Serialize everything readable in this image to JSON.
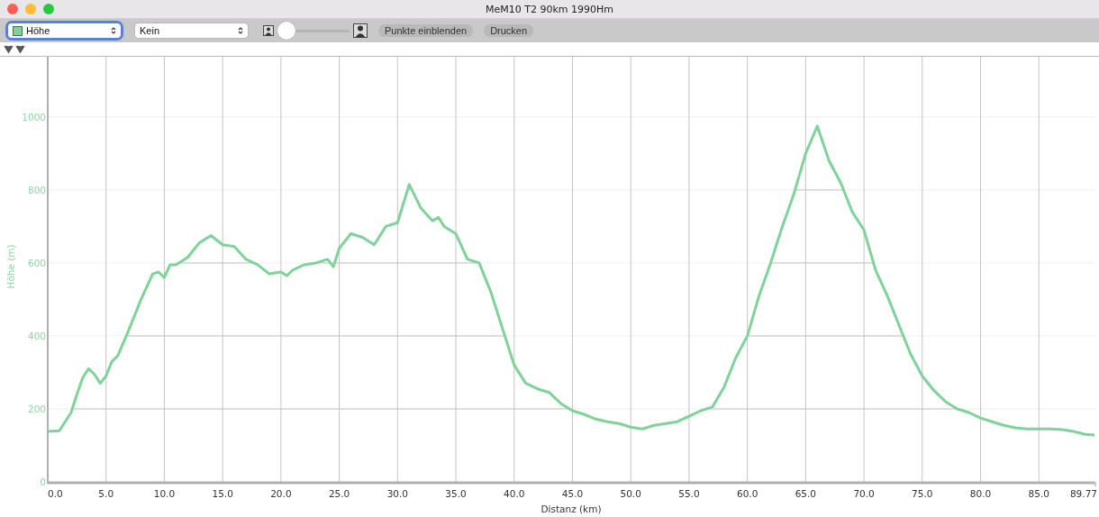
{
  "window": {
    "title": "MeM10 T2 90km 1990Hm"
  },
  "toolbar": {
    "selects": [
      {
        "value": "Höhe",
        "focused": true,
        "color": "#7fd39a"
      },
      {
        "value": "Kein",
        "focused": false
      }
    ],
    "zoom_slider": {
      "level": 0
    },
    "buttons": [
      "Punkte einblenden",
      "Drucken"
    ]
  },
  "chart": {
    "chart_data": {
      "type": "line",
      "xlabel": "Distanz (km)",
      "ylabel": "Höhe (m)",
      "x": [
        0,
        1,
        2,
        2.5,
        3,
        3.5,
        4,
        4.5,
        5,
        5.5,
        6,
        7,
        8,
        9,
        9.5,
        10,
        10.5,
        11,
        12,
        13,
        14,
        15,
        16,
        17,
        18,
        19,
        20,
        20.5,
        21,
        22,
        23,
        24,
        24.5,
        25,
        26,
        27,
        28,
        29,
        30,
        31,
        32,
        33,
        33.5,
        34,
        35,
        36,
        37,
        38,
        39,
        40,
        41,
        42,
        43,
        44,
        45,
        46,
        47,
        48,
        49,
        50,
        51,
        52,
        53,
        54,
        55,
        56,
        57,
        58,
        59,
        60,
        61,
        62,
        63,
        64,
        65,
        66,
        67,
        68,
        69,
        70,
        71,
        72,
        73,
        74,
        75,
        76,
        77,
        78,
        79,
        80,
        81,
        82,
        83,
        84,
        85,
        86,
        87,
        88,
        89,
        89.77
      ],
      "series": [
        {
          "color": "#7fd39a",
          "values": [
            138,
            140,
            190,
            240,
            285,
            310,
            295,
            270,
            290,
            330,
            345,
            420,
            500,
            570,
            575,
            560,
            595,
            595,
            615,
            655,
            675,
            650,
            645,
            610,
            595,
            570,
            575,
            565,
            580,
            595,
            600,
            610,
            590,
            640,
            680,
            670,
            650,
            700,
            710,
            815,
            750,
            715,
            725,
            700,
            680,
            610,
            600,
            520,
            420,
            320,
            270,
            255,
            245,
            215,
            195,
            185,
            172,
            165,
            160,
            150,
            145,
            155,
            160,
            165,
            180,
            195,
            205,
            260,
            340,
            400,
            510,
            600,
            700,
            790,
            900,
            975,
            880,
            820,
            740,
            690,
            580,
            510,
            430,
            350,
            290,
            250,
            220,
            200,
            190,
            175,
            165,
            155,
            148,
            145,
            145,
            145,
            143,
            138,
            130,
            128
          ]
        }
      ],
      "xlim": [
        0,
        89.77
      ],
      "ylim": [
        0,
        1165
      ],
      "xticks": [
        {
          "value": 0,
          "label": "0.0"
        },
        {
          "value": 5,
          "label": "5.0"
        },
        {
          "value": 10,
          "label": "10.0"
        },
        {
          "value": 15,
          "label": "15.0"
        },
        {
          "value": 20,
          "label": "20.0"
        },
        {
          "value": 25,
          "label": "25.0"
        },
        {
          "value": 30,
          "label": "30.0"
        },
        {
          "value": 35,
          "label": "35.0"
        },
        {
          "value": 40,
          "label": "40.0"
        },
        {
          "value": 45,
          "label": "45.0"
        },
        {
          "value": 50,
          "label": "50.0"
        },
        {
          "value": 55,
          "label": "55.0"
        },
        {
          "value": 60,
          "label": "60.0"
        },
        {
          "value": 65,
          "label": "65.0"
        },
        {
          "value": 70,
          "label": "70.0"
        },
        {
          "value": 75,
          "label": "75.0"
        },
        {
          "value": 80,
          "label": "80.0"
        },
        {
          "value": 85,
          "label": "85.0"
        },
        {
          "value": 89.77,
          "label": "89.77"
        }
      ],
      "grid": true,
      "yticks": [
        0,
        200,
        400,
        600,
        800,
        1000
      ]
    }
  }
}
